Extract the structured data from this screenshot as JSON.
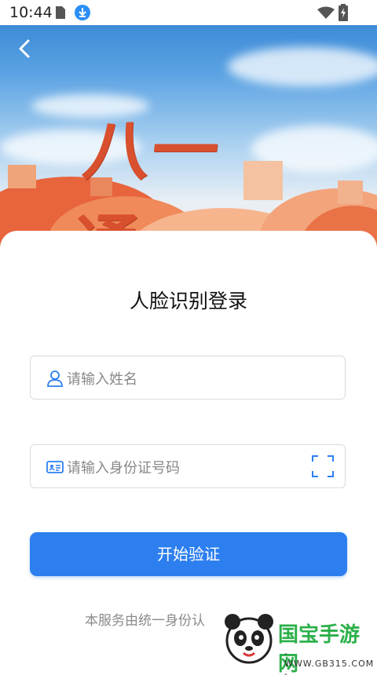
{
  "status_bar": {
    "time": "10:44",
    "icons": [
      "sim-card-icon",
      "download-icon",
      "wifi-icon",
      "battery-charging-icon"
    ]
  },
  "banner": {
    "calligraphy_text": "八一通"
  },
  "login": {
    "title": "人脸识别登录",
    "name_placeholder": "请输入姓名",
    "id_placeholder": "请输入身份证号码",
    "submit_label": "开始验证",
    "footer_text": "本服务由统一身份认"
  },
  "watermark": {
    "brand": "国宝手游网",
    "url": "- WWW.GB315.COM -"
  },
  "colors": {
    "accent": "#2d7ff0",
    "banner_red": "#d9502f"
  }
}
